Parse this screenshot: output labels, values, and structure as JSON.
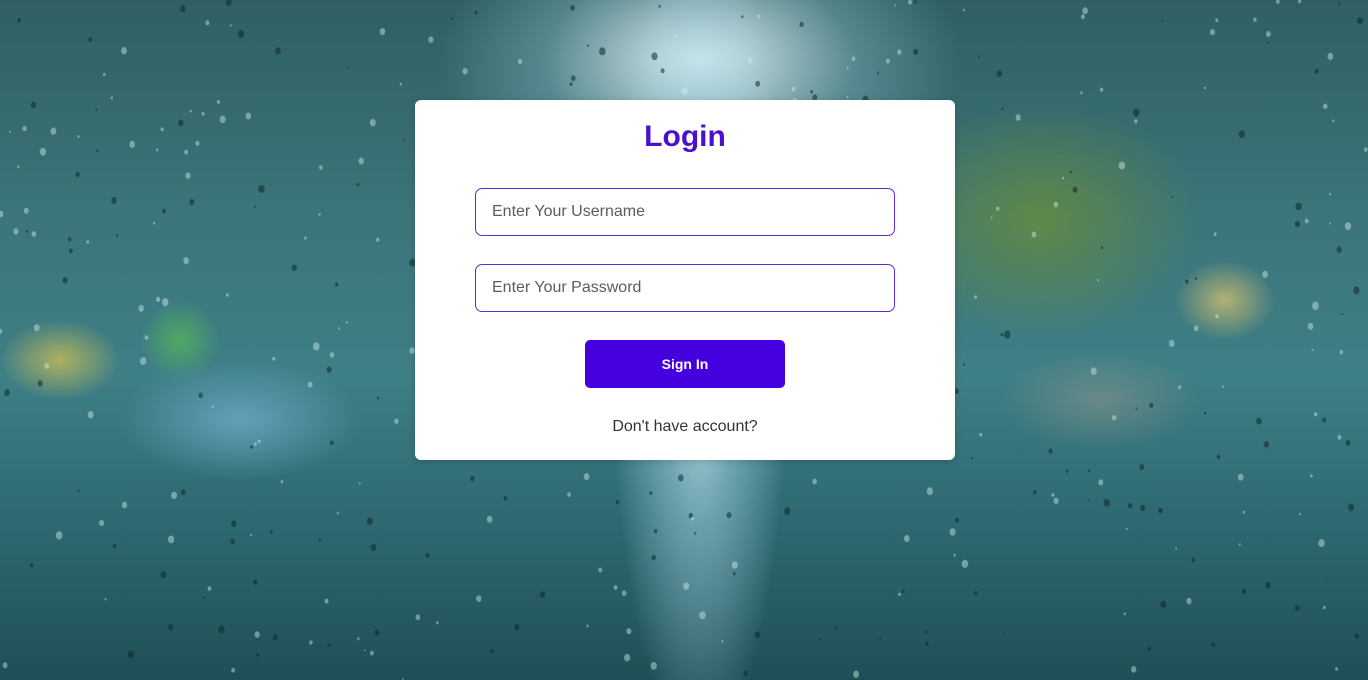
{
  "login": {
    "title": "Login",
    "username_placeholder": "Enter Your Username",
    "password_placeholder": "Enter Your Password",
    "submit_label": "Sign In",
    "signup_link": "Don't have account?"
  },
  "colors": {
    "accent": "#4500e0",
    "title": "#4d0fcf",
    "field_border": "#5b2bd0",
    "card_background": "#ffffff"
  }
}
